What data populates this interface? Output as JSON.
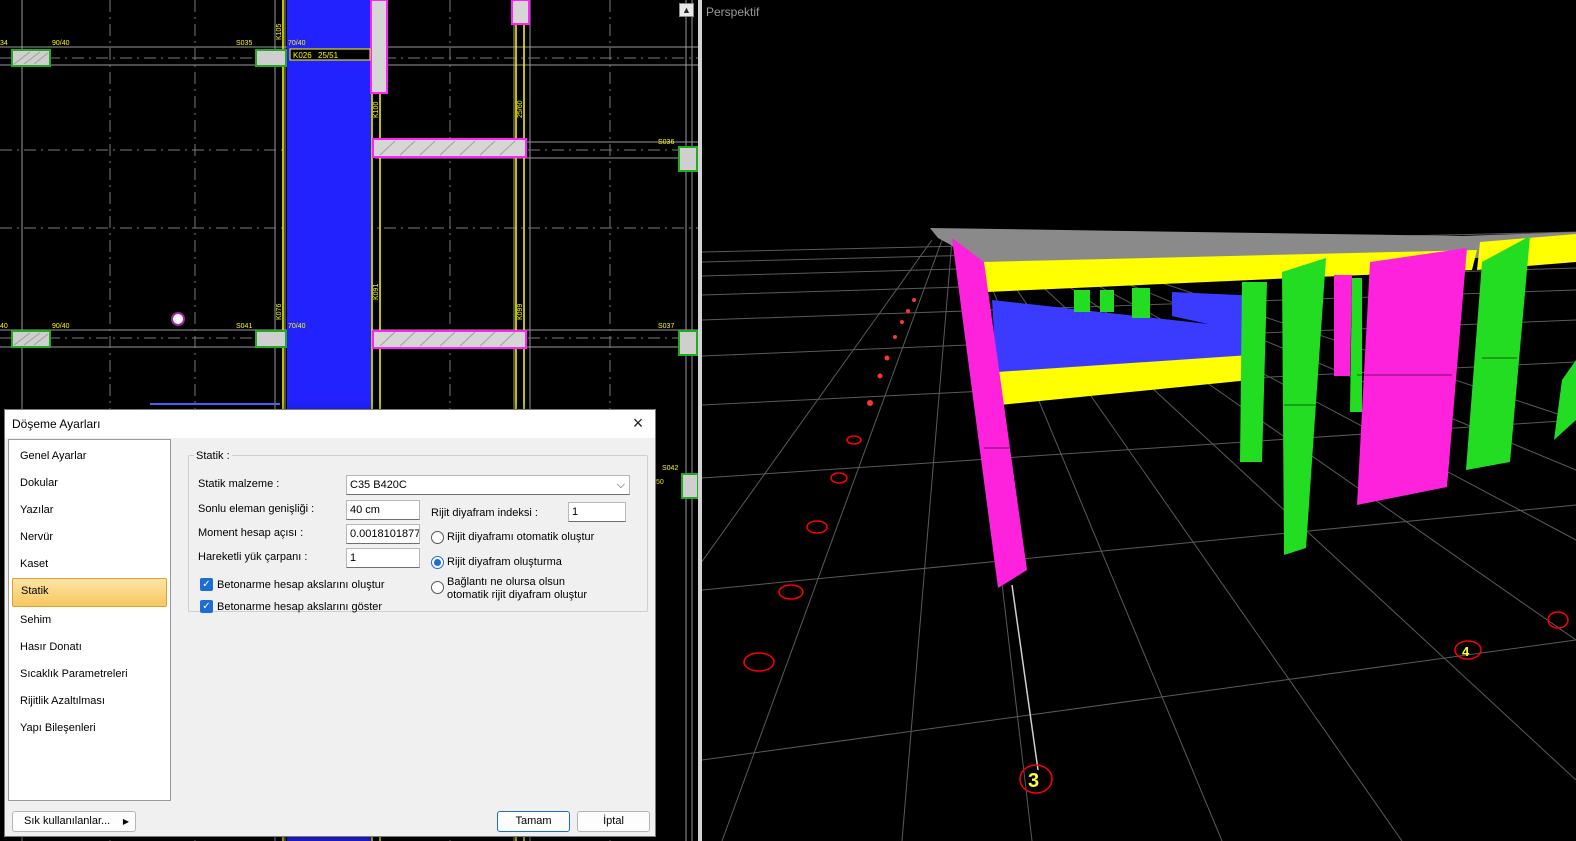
{
  "plan": {
    "labels": [
      "34",
      "90/40",
      "S035",
      "70/40",
      "K026",
      "25/51",
      "K105",
      "K100",
      "25/60",
      "S036",
      "40",
      "90/40",
      "S041",
      "70/40",
      "K076",
      "25/51",
      "K091",
      "25/51",
      "K099",
      "25/60",
      "S037",
      "S042",
      "50"
    ]
  },
  "perspective": {
    "title": "Perspektif",
    "axis_labels": [
      "3",
      "4"
    ]
  },
  "dialog": {
    "title": "Döşeme Ayarları",
    "close_glyph": "×",
    "nav_items": [
      {
        "label": "Genel Ayarlar"
      },
      {
        "label": "Dokular"
      },
      {
        "label": "Yazılar"
      },
      {
        "label": "Nervür"
      },
      {
        "label": "Kaset"
      },
      {
        "label": "Statik",
        "active": true
      },
      {
        "label": "Sehim"
      },
      {
        "label": "Hasır Donatı"
      },
      {
        "label": "Sıcaklık Parametreleri"
      },
      {
        "label": "Rijitlik Azaltılması"
      },
      {
        "label": "Yapı Bileşenleri"
      }
    ],
    "section_title": "Statik :",
    "material_label": "Statik malzeme :",
    "material_value": "C35 B420C",
    "element_width_label": "Sonlu eleman genişliği :",
    "element_width_value": "40 cm",
    "moment_angle_label": "Moment hesap açısı :",
    "moment_angle_value": "0.0018101877",
    "live_load_label": "Hareketli yük çarpanı :",
    "live_load_value": "1",
    "diaphragm_index_label": "Rijit diyafram indeksi :",
    "diaphragm_index_value": "1",
    "check1_label": "Betonarme hesap akslarını oluştur",
    "check2_label": "Betonarme hesap akslarını göster",
    "radio1_label": "Rijit diyaframı otomatik oluştur",
    "radio2_label": "Rijit diyafram oluşturma",
    "radio3_line1": "Bağlantı ne olursa olsun",
    "radio3_line2": "otomatik rijit diyafram oluştur",
    "selected_radio": 2,
    "favorites_button": "Sık kullanılanlar...",
    "ok_button": "Tamam",
    "cancel_button": "İptal"
  },
  "colors": {
    "accent": "#1c6ed4",
    "slab_blue": "#3b3bff",
    "beam_yellow": "#ffff00",
    "column_green": "#22dd22",
    "wall_magenta": "#ff22dd"
  }
}
